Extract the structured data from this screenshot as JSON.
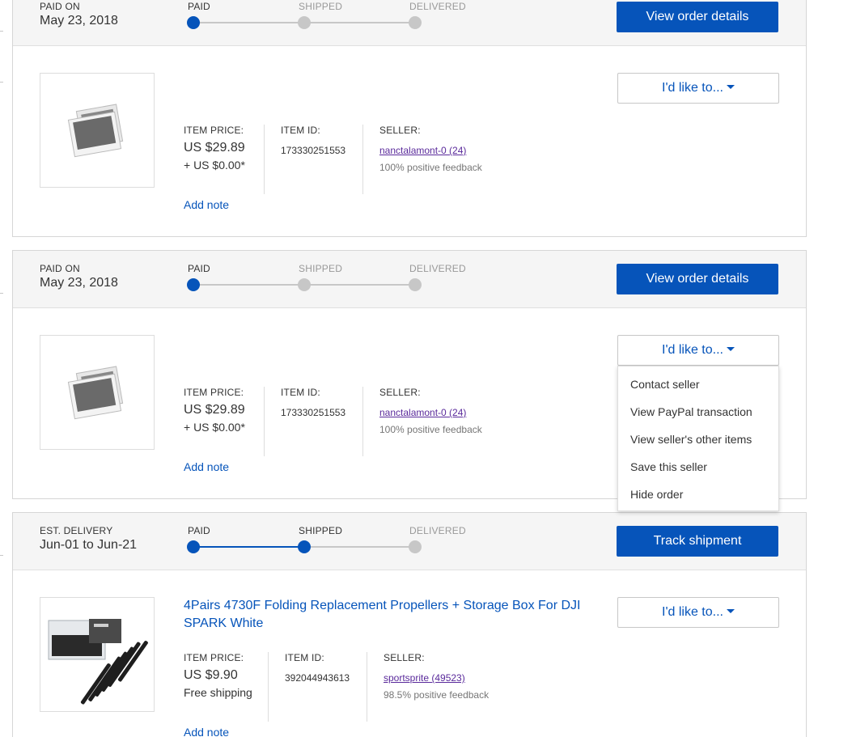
{
  "orders": [
    {
      "header": {
        "label": "PAID ON",
        "date": "May 23, 2018",
        "steps": [
          {
            "label": "PAID",
            "state": "done"
          },
          {
            "label": "SHIPPED",
            "state": "pending"
          },
          {
            "label": "DELIVERED",
            "state": "pending"
          }
        ],
        "action_label": "View order details"
      },
      "item": {
        "image": "placeholder-photo-icon",
        "title": "",
        "price_label": "ITEM PRICE:",
        "price": "US $29.89",
        "shipping": "+ US $0.00*",
        "item_id_label": "ITEM ID:",
        "item_id": "173330251553",
        "seller_label": "SELLER:",
        "seller": "nanctalamont-0 (24)",
        "feedback": "100% positive feedback",
        "add_note": "Add note",
        "ilike_label": "I'd like to..."
      }
    },
    {
      "header": {
        "label": "PAID ON",
        "date": "May 23, 2018",
        "steps": [
          {
            "label": "PAID",
            "state": "done"
          },
          {
            "label": "SHIPPED",
            "state": "pending"
          },
          {
            "label": "DELIVERED",
            "state": "pending"
          }
        ],
        "action_label": "View order details"
      },
      "item": {
        "image": "placeholder-photo-icon",
        "title": "",
        "price_label": "ITEM PRICE:",
        "price": "US $29.89",
        "shipping": "+ US $0.00*",
        "item_id_label": "ITEM ID:",
        "item_id": "173330251553",
        "seller_label": "SELLER:",
        "seller": "nanctalamont-0 (24)",
        "feedback": "100% positive feedback",
        "add_note": "Add note",
        "ilike_label": "I'd like to..."
      }
    },
    {
      "header": {
        "label": "EST. DELIVERY",
        "date": "Jun-01 to Jun-21",
        "steps": [
          {
            "label": "PAID",
            "state": "done"
          },
          {
            "label": "SHIPPED",
            "state": "done"
          },
          {
            "label": "DELIVERED",
            "state": "pending"
          }
        ],
        "action_label": "Track shipment"
      },
      "item": {
        "image": "propellers-product-photo",
        "title": "4Pairs 4730F Folding Replacement Propellers + Storage Box For DJI SPARK White",
        "price_label": "ITEM PRICE:",
        "price": "US $9.90",
        "shipping": "Free shipping",
        "item_id_label": "ITEM ID:",
        "item_id": "392044943613",
        "seller_label": "SELLER:",
        "seller": "sportsprite (49523)",
        "feedback": "98.5% positive feedback",
        "add_note": "Add note",
        "ilike_label": "I'd like to..."
      }
    }
  ],
  "dropdown_menu": {
    "open_for_order": 2,
    "items": [
      "Contact seller",
      "View PayPal transaction",
      "View seller's other items",
      "Save this seller",
      "Hide order"
    ]
  },
  "colors": {
    "accent": "#0654ba",
    "header_bg": "#f5f5f5",
    "step_pending": "#c7c7c7",
    "seller_link": "#5a2a9b"
  }
}
